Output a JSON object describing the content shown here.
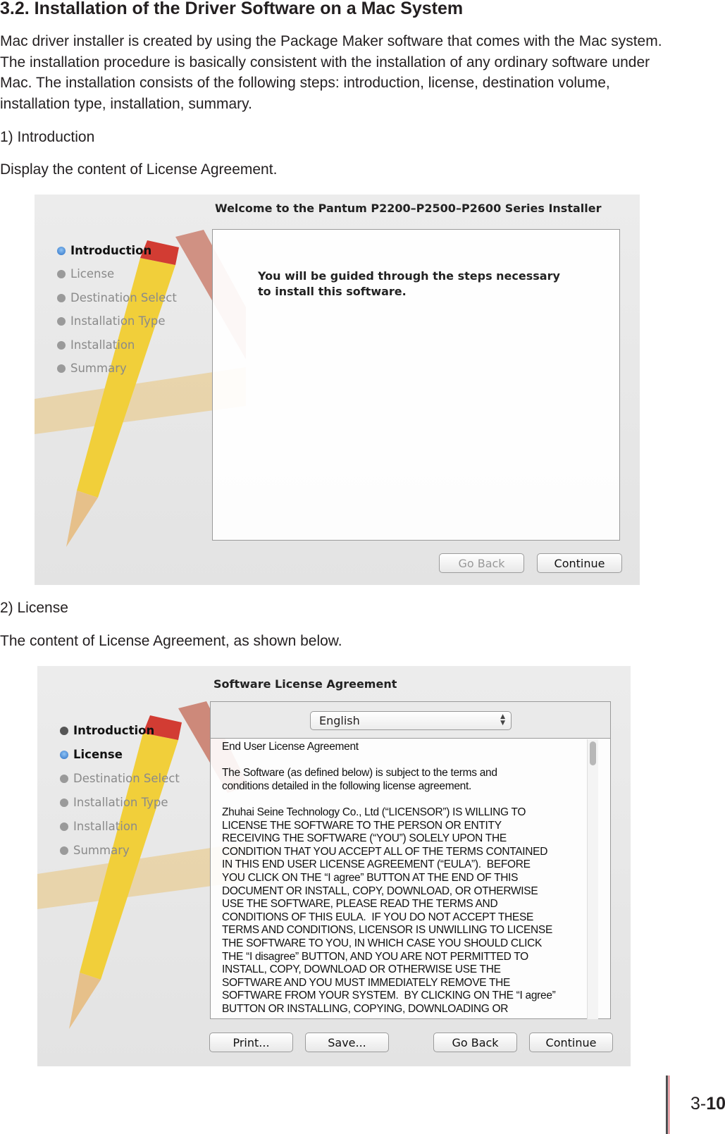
{
  "heading": "3.2. Installation of the Driver Software on a Mac System",
  "intro_paragraph": "Mac driver installer is created by using the Package Maker software that comes with the Mac system. The installation procedure is basically consistent with the installation of any ordinary software under Mac. The installation consists of the following steps: introduction, license, destination volume, installation type, installation, summary.",
  "step1": {
    "title": "1) Introduction",
    "desc": "Display the content of License Agreement."
  },
  "step2": {
    "title": "2) License",
    "desc": "The content of License Agreement, as shown below."
  },
  "window1": {
    "title": "Welcome to the Pantum P2200–P2500–P2600 Series Installer",
    "sidebar": [
      "Introduction",
      "License",
      "Destination Select",
      "Installation Type",
      "Installation",
      "Summary"
    ],
    "message": "You will be guided through the steps necessary to install this software.",
    "go_back": "Go Back",
    "continue": "Continue"
  },
  "window2": {
    "title": "Software License Agreement",
    "sidebar": [
      "Introduction",
      "License",
      "Destination Select",
      "Installation Type",
      "Installation",
      "Summary"
    ],
    "language": "English",
    "license_text": "End User License Agreement\n\nThe Software (as defined below) is subject to the terms and\nconditions detailed in the following license agreement.\n\nZhuhai Seine Technology Co., Ltd (“LICENSOR”) IS WILLING TO\nLICENSE THE SOFTWARE TO THE PERSON OR ENTITY\nRECEIVING THE SOFTWARE (“YOU”) SOLELY UPON THE\nCONDITION THAT YOU ACCEPT ALL OF THE TERMS CONTAINED\nIN THIS END USER LICENSE AGREEMENT (“EULA”).  BEFORE\nYOU CLICK ON THE “I agree” BUTTON AT THE END OF THIS\nDOCUMENT OR INSTALL, COPY, DOWNLOAD, OR OTHERWISE\nUSE THE SOFTWARE, PLEASE READ THE TERMS AND\nCONDITIONS OF THIS EULA.  IF YOU DO NOT ACCEPT THESE\nTERMS AND CONDITIONS, LICENSOR IS UNWILLING TO LICENSE\nTHE SOFTWARE TO YOU, IN WHICH CASE YOU SHOULD CLICK\nTHE “I disagree” BUTTON, AND YOU ARE NOT PERMITTED TO\nINSTALL, COPY, DOWNLOAD OR OTHERWISE USE THE\nSOFTWARE AND YOU MUST IMMEDIATELY REMOVE THE\nSOFTWARE FROM YOUR SYSTEM.  BY CLICKING ON THE “I agree”\nBUTTON OR INSTALLING, COPYING, DOWNLOADING OR",
    "print": "Print...",
    "save": "Save...",
    "go_back": "Go Back",
    "continue": "Continue"
  },
  "page_number": {
    "chapter": "3-",
    "page": "10"
  },
  "colors": {
    "accent_line": "#c8202f",
    "bar": "#4d4d4f"
  }
}
